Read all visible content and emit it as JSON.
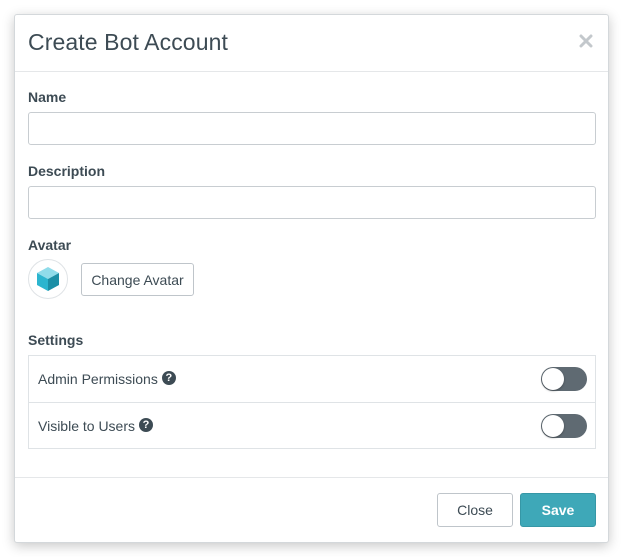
{
  "modal": {
    "title": "Create Bot Account",
    "close_icon": "close-icon"
  },
  "form": {
    "name_label": "Name",
    "name_value": "",
    "description_label": "Description",
    "description_value": "",
    "avatar_label": "Avatar",
    "change_avatar_label": "Change Avatar",
    "avatar_icon": "bot-avatar-icon"
  },
  "settings": {
    "heading": "Settings",
    "rows": [
      {
        "label": "Admin Permissions",
        "help_icon": "question-circle-icon",
        "enabled": false
      },
      {
        "label": "Visible to Users",
        "help_icon": "question-circle-icon",
        "enabled": false
      }
    ]
  },
  "footer": {
    "close_label": "Close",
    "save_label": "Save"
  },
  "colors": {
    "accent": "#3ea8b8",
    "text": "#3d4b54",
    "toggle_off": "#5f6a72",
    "avatar_cyan": "#2cb5cf"
  }
}
